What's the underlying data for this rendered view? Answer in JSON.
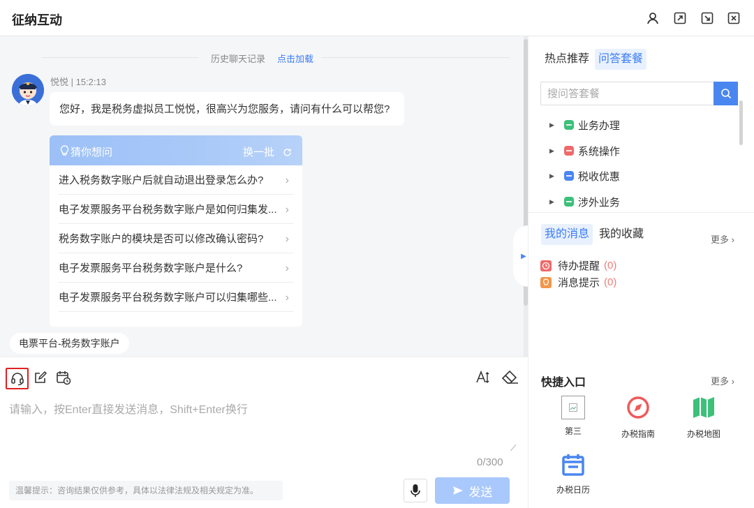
{
  "window": {
    "title": "征纳互动"
  },
  "chat": {
    "history_label": "历史聊天记录",
    "history_load": "点击加载",
    "sender": "悦悦 | 15:2:13",
    "greeting": "您好，我是税务虚拟员工悦悦，很高兴为您服务，请问有什么可以帮您?",
    "guess": {
      "title": "猜你想问",
      "refresh_label": "换一批",
      "items": [
        "进入税务数字账户后就自动退出登录怎么办?",
        "电子发票服务平台税务数字账户是如何归集发...",
        "税务数字账户的模块是否可以修改确认密码?",
        "电子发票服务平台税务数字账户是什么?",
        "电子发票服务平台税务数字账户可以归集哪些..."
      ]
    },
    "topic_chip": "电票平台-税务数字账户"
  },
  "composer": {
    "placeholder": "请输入，按Enter直接发送消息，Shift+Enter换行",
    "counter": "0/300",
    "tip": "温馨提示：咨询结果仅供参考，具体以法律法规及相关规定为准。",
    "send_label": "发送"
  },
  "side": {
    "tabs": [
      "热点推荐",
      "问答套餐"
    ],
    "active_tab": "问答套餐",
    "search_placeholder": "搜问答套餐",
    "categories": [
      {
        "label": "业务办理",
        "color": "#3cc07a"
      },
      {
        "label": "系统操作",
        "color": "#ef6a6a"
      },
      {
        "label": "税收优惠",
        "color": "#4a86f0"
      },
      {
        "label": "涉外业务",
        "color": "#3cc07a"
      }
    ],
    "message_tabs": [
      "我的消息",
      "我的收藏"
    ],
    "more_label": "更多",
    "messages": [
      {
        "label": "待办提醒",
        "count": "(0)",
        "color": "#ef6a6a"
      },
      {
        "label": "消息提示",
        "count": "(0)",
        "color": "#f3954a"
      }
    ],
    "quick_title": "快捷入口",
    "quick_more": "更多",
    "quick_items": [
      {
        "label": "第三",
        "icon": "broken-image-icon"
      },
      {
        "label": "办税指南",
        "icon": "compass-icon",
        "color": "#ef5a5a"
      },
      {
        "label": "办税地图",
        "icon": "map-icon",
        "color": "#3cc07a"
      },
      {
        "label": "办税日历",
        "icon": "calendar-icon",
        "color": "#4a86f0"
      }
    ]
  }
}
